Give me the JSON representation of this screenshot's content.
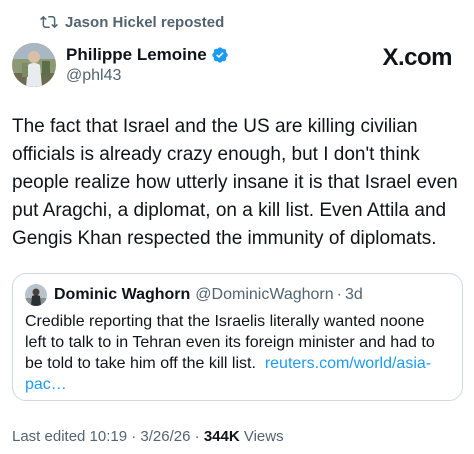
{
  "repost": {
    "label": "Jason Hickel reposted",
    "icon": "repost-icon"
  },
  "author": {
    "display_name": "Philippe Lemoine",
    "handle": "@phl43",
    "verified": true,
    "verified_color": "#1d9bf0"
  },
  "brand": {
    "logo_text": "X.com"
  },
  "tweet": {
    "text": "The fact that Israel and the US are killing civilian officials is already crazy enough, but I don't think people realize how utterly insane it is that Israel even put Aragchi, a diplomat, on a kill list. Even Attila and Gengis Khan respected the immunity of diplomats."
  },
  "quote": {
    "display_name": "Dominic Waghorn",
    "handle": "@DominicWaghorn",
    "separator": "·",
    "date": "3d",
    "text": "Credible reporting that the Israelis literally wanted noone left to talk to in Tehran even its foreign minister and had to be told to take him off the kill list.",
    "link": "reuters.com/world/asia-pac…"
  },
  "meta": {
    "edited_label": "Last edited 10:19 · 3/26/26",
    "separator": "·",
    "views_count": "344K",
    "views_label": "Views"
  },
  "colors": {
    "text_primary": "#0f1419",
    "text_secondary": "#536471",
    "link": "#1d9bf0",
    "border": "#cfd9de"
  }
}
